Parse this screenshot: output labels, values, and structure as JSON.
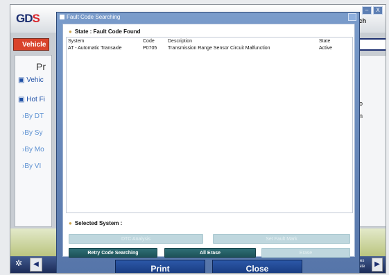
{
  "background_app": {
    "logo": {
      "main": "GD",
      "mark": "S"
    },
    "vehicle_tab": "Vehicle",
    "left_panel": {
      "heading": "Pr",
      "items": [
        "Vehic",
        "Hot Fi"
      ],
      "subitems": [
        "By DT",
        "By Sy",
        "By Mo",
        "By VI"
      ]
    },
    "right_top": "arch",
    "right_panel": {
      "lines": [
        "o",
        "n"
      ]
    },
    "window_buttons": [
      "–",
      "X"
    ],
    "bottom_bar": {
      "left_arrow": "◀",
      "right_arrow": "▶",
      "right_text": "lsanes update"
    }
  },
  "dialog": {
    "title": "Fault Code Searching",
    "state_heading": "State : Fault Code Found",
    "columns": {
      "system": "System",
      "code": "Code",
      "description": "Description",
      "state": "State"
    },
    "rows": [
      {
        "system": "AT - Automatic Transaxle",
        "code": "P0705",
        "description": "Transmission Range Sensor Circuit Malfunction",
        "state": "Active"
      }
    ],
    "selected_heading": "Selected System :",
    "buttons": {
      "top_left_disabled": "DTC Analysis",
      "top_right_disabled": "Set Fault Mark",
      "retry": "Retry Code Searching",
      "all_erase": "All Erase",
      "right_disabled": "Erase",
      "print": "Print",
      "close": "Close"
    }
  },
  "colors": {
    "accent_dark": "#1d5258",
    "primary_blue": "#16377b",
    "dialog_blue": "#5574a8"
  }
}
